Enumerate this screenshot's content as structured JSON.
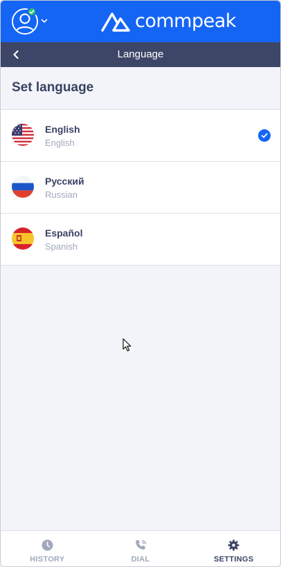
{
  "header": {
    "brand_name": "commpeak",
    "user_status": "online",
    "avatar_icon": "user-avatar-icon"
  },
  "subheader": {
    "title": "Language",
    "back_icon": "chevron-left-icon"
  },
  "section": {
    "title": "Set language"
  },
  "languages": [
    {
      "name": "English",
      "subtitle": "English",
      "flag": "us-flag-icon",
      "selected": true
    },
    {
      "name": "Русский",
      "subtitle": "Russian",
      "flag": "russia-flag-icon",
      "selected": false
    },
    {
      "name": "Español",
      "subtitle": "Spanish",
      "flag": "spain-flag-icon",
      "selected": false
    }
  ],
  "bottom_nav": {
    "items": [
      {
        "label": "HISTORY",
        "icon": "clock-icon",
        "active": false
      },
      {
        "label": "DIAL",
        "icon": "phone-dial-icon",
        "active": false
      },
      {
        "label": "SETTINGS",
        "icon": "gear-icon",
        "active": true
      }
    ]
  },
  "colors": {
    "primary": "#1565f5",
    "subheader": "#3d4667",
    "text_dark": "#3a4263",
    "text_muted": "#a2a8bd",
    "status_online": "#29c46b"
  }
}
